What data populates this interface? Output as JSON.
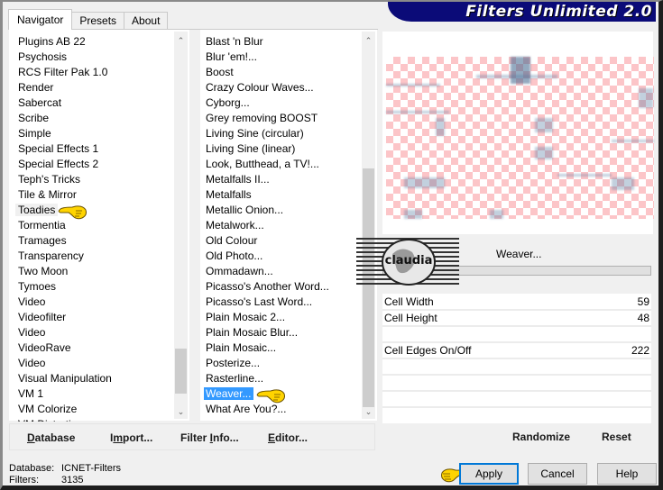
{
  "app": {
    "title": "Filters Unlimited 2.0"
  },
  "tabs": [
    {
      "label": "Navigator",
      "active": true
    },
    {
      "label": "Presets",
      "active": false
    },
    {
      "label": "About",
      "active": false
    }
  ],
  "categories": {
    "items": [
      "Plugins AB 22",
      "Psychosis",
      "RCS Filter Pak 1.0",
      "Render",
      "Sabercat",
      "Scribe",
      "Simple",
      "Special Effects 1",
      "Special Effects 2",
      "Teph's Tricks",
      "Tile & Mirror",
      "Toadies",
      "Tormentia",
      "Tramages",
      "Transparency",
      "Two Moon",
      "Tymoes",
      "Video",
      "Videofilter",
      "Video",
      "VideoRave",
      "Video",
      "Visual Manipulation",
      "VM 1",
      "VM Colorize",
      "VM Distortion"
    ],
    "selected": "Toadies",
    "scroll_position": 0.85
  },
  "filters": {
    "items": [
      "Blast 'n Blur",
      "Blur 'em!...",
      "Boost",
      "Crazy Colour Waves...",
      "Cyborg...",
      "Grey removing BOOST",
      "Living Sine (circular)",
      "Living Sine (linear)",
      "Look, Butthead, a TV!...",
      "Metalfalls II...",
      "Metalfalls",
      "Metallic Onion...",
      "Metalwork...",
      "Old Colour",
      "Old Photo...",
      "Ommadawn...",
      "Picasso's Another Word...",
      "Picasso's Last Word...",
      "Plain Mosaic 2...",
      "Plain Mosaic Blur...",
      "Plain Mosaic...",
      "Posterize...",
      "Rasterline...",
      "Weaver...",
      "What Are You?..."
    ],
    "selected": "Weaver...",
    "scroll_position": 1.0
  },
  "preview": {
    "filter_name": "Weaver...",
    "colors": {
      "checker": "#fcc5c8",
      "smudge": "#5078a0"
    }
  },
  "params": [
    {
      "label": "Cell Width",
      "value": "59"
    },
    {
      "label": "Cell Height",
      "value": "48"
    },
    {
      "label": "",
      "value": ""
    },
    {
      "label": "Cell Edges On/Off",
      "value": "222"
    },
    {
      "label": "",
      "value": ""
    },
    {
      "label": "",
      "value": ""
    },
    {
      "label": "",
      "value": ""
    }
  ],
  "watermark": {
    "text": "claudia"
  },
  "toolbar": {
    "database_label": "Database",
    "import_label": "Import...",
    "filter_info_label": "Filter Info...",
    "editor_label": "Editor...",
    "randomize_label": "Randomize",
    "reset_label": "Reset"
  },
  "status": {
    "database_key": "Database:",
    "database_value": "ICNET-Filters",
    "filters_key": "Filters:",
    "filters_value": "3135"
  },
  "buttons": {
    "apply_label": "Apply",
    "cancel_label": "Cancel",
    "help_label": "Help"
  },
  "icons": {
    "pointer": "pointing-hand-icon",
    "scroll_up": "chevron-up-icon",
    "scroll_down": "chevron-down-icon"
  }
}
